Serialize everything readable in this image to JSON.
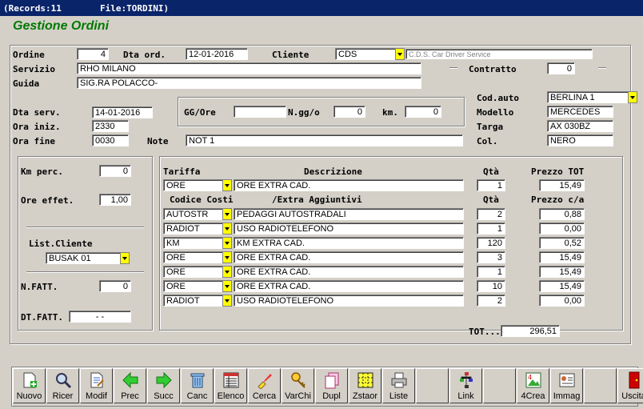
{
  "window": {
    "records": "(Records:11",
    "file": "File:TORDINI)"
  },
  "app_title": "Gestione Ordini",
  "labels": {
    "ordine": "Ordine",
    "dta_ord": "Dta ord.",
    "cliente": "Cliente",
    "servizio": "Servizio",
    "guida": "Guida",
    "contratto": "Contratto",
    "cod_auto": "Cod.auto",
    "modello": "Modello",
    "targa": "Targa",
    "col": "Col.",
    "dta_serv": "Dta serv.",
    "ora_iniz": "Ora iniz.",
    "ora_fine": "Ora fine",
    "gg_ore": "GG/Ore",
    "ngg": "N.gg/o",
    "km": "km.",
    "note": "Note",
    "km_perc": "Km perc.",
    "ore_effet": "Ore effet.",
    "list_cliente": "List.Cliente",
    "n_fatt": "N.FATT.",
    "dt_fatt": "DT.FATT."
  },
  "values": {
    "ordine": "4",
    "dta_ord": "12-01-2016",
    "cliente_code": "CDS",
    "cliente_name": "C.D.S. Car Driver Service",
    "servizio": "RHO MILANO",
    "guida": "SIG.RA POLACCO-",
    "contratto": "0",
    "cod_auto": "BERLINA 1",
    "modello": "MERCEDES",
    "targa": "AX 030BZ",
    "col": "NERO",
    "dta_serv": "14-01-2016",
    "ora_iniz": "2330",
    "ora_fine": "0030",
    "gg_ore": "",
    "ngg": "0",
    "km": "0",
    "note": "NOT 1",
    "km_perc": "0",
    "ore_effet": "1,00",
    "list_cliente": "BUSAK 01",
    "n_fatt": "0",
    "dt_fatt": "-   -",
    "tot_label": "TOT...",
    "tot": "296,51"
  },
  "tariffa": {
    "headers": {
      "tariffa": "Tariffa",
      "descrizione": "Descrizione",
      "qta": "Qtà",
      "prezzo": "Prezzo TOT"
    },
    "row": {
      "code": "ORE",
      "desc": "ORE EXTRA CAD.",
      "qta": "1",
      "prezzo": "15,49"
    }
  },
  "costi": {
    "headers": {
      "codice": "Codice Costi",
      "extra": "/Extra Aggiuntivi",
      "qta": "Qtà",
      "prezzo": "Prezzo c/a"
    },
    "rows": [
      {
        "code": "AUTOSTR",
        "desc": "PEDAGGI AUTOSTRADALI",
        "qta": "2",
        "prezzo": "0,88"
      },
      {
        "code": "RADIOT",
        "desc": "USO RADIOTELEFONO",
        "qta": "1",
        "prezzo": "0,00"
      },
      {
        "code": "KM",
        "desc": "KM EXTRA CAD.",
        "qta": "120",
        "prezzo": "0,52"
      },
      {
        "code": "ORE",
        "desc": "ORE EXTRA CAD.",
        "qta": "3",
        "prezzo": "15,49"
      },
      {
        "code": "ORE",
        "desc": "ORE EXTRA CAD.",
        "qta": "1",
        "prezzo": "15,49"
      },
      {
        "code": "ORE",
        "desc": "ORE EXTRA CAD.",
        "qta": "10",
        "prezzo": "15,49"
      },
      {
        "code": "RADIOT",
        "desc": "USO RADIOTELEFONO",
        "qta": "2",
        "prezzo": "0,00"
      }
    ]
  },
  "toolbar": [
    {
      "label": "Nuovo",
      "icon": "new-document-icon"
    },
    {
      "label": "Ricer",
      "icon": "magnifier-icon"
    },
    {
      "label": "Modif",
      "icon": "edit-document-icon"
    },
    {
      "label": "Prec",
      "icon": "arrow-left-icon"
    },
    {
      "label": "Succ",
      "icon": "arrow-right-icon"
    },
    {
      "label": "Canc",
      "icon": "trash-icon"
    },
    {
      "label": "Elenco",
      "icon": "list-icon"
    },
    {
      "label": "Cerca",
      "icon": "search-brush-icon"
    },
    {
      "label": "VarChi",
      "icon": "keys-icon"
    },
    {
      "label": "Dupl",
      "icon": "duplicate-icon"
    },
    {
      "label": "Zstaor",
      "icon": "checker-icon"
    },
    {
      "label": "Liste",
      "icon": "printer-icon"
    },
    {
      "label": "",
      "icon": "blank"
    },
    {
      "label": "Link",
      "icon": "link-tree-icon"
    },
    {
      "label": "",
      "icon": "blank"
    },
    {
      "label": "4Crea",
      "icon": "create-icon"
    },
    {
      "label": "Immag",
      "icon": "image-card-icon"
    },
    {
      "label": "",
      "icon": "blank"
    },
    {
      "label": "Uscita",
      "icon": "exit-door-icon"
    }
  ],
  "colors": {
    "title_bar": "#0a246a",
    "app_title": "#007a00",
    "dropdown": "#ffff00"
  }
}
